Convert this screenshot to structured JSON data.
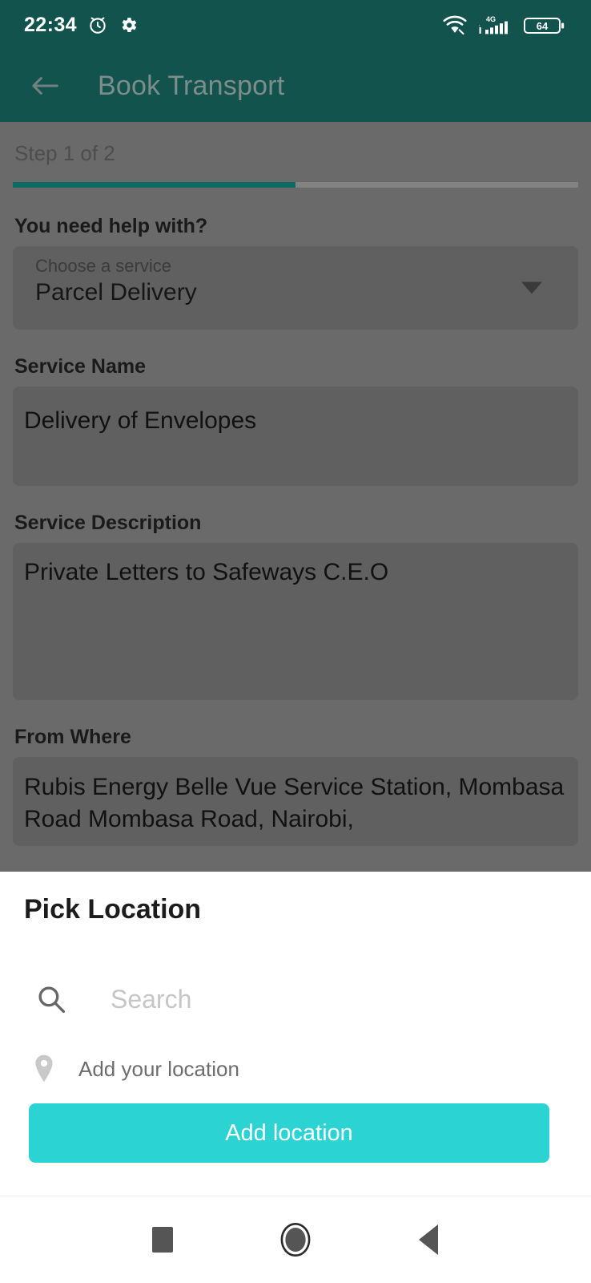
{
  "statusbar": {
    "time": "22:34",
    "icons_left": [
      "alarm-icon",
      "gear-icon"
    ],
    "icons_right": [
      "wifi-icon",
      "signal-4g-icon",
      "battery-icon"
    ],
    "network_label": "4G",
    "battery_level": "64"
  },
  "appbar": {
    "back_icon": "back-arrow-icon",
    "title": "Book Transport",
    "background_color": "#13534d"
  },
  "form": {
    "step_text": "Step 1 of 2",
    "progress_percent": 50,
    "progress_color": "#0e6b63",
    "service_question_label": "You need help with?",
    "service_select": {
      "hint": "Choose a service",
      "value": "Parcel Delivery",
      "caret_icon": "chevron-down-icon"
    },
    "service_name_label": "Service Name",
    "service_name_value": "Delivery of Envelopes",
    "service_description_label": "Service Description",
    "service_description_value": "Private Letters to Safeways C.E.O",
    "from_where_label": "From Where",
    "from_where_value": "Rubis Energy Belle Vue Service Station, Mombasa Road Mombasa Road, Nairobi,"
  },
  "sheet": {
    "title": "Pick Location",
    "search": {
      "icon": "search-icon",
      "placeholder": "Search",
      "value": ""
    },
    "add_location_row": {
      "icon": "map-pin-icon",
      "label": "Add your location"
    },
    "primary_button": {
      "label": "Add location",
      "color": "#2bd3d3"
    }
  },
  "navbar": {
    "recents_icon": "square-recents-icon",
    "home_icon": "circle-home-icon",
    "back_icon": "triangle-back-icon"
  }
}
